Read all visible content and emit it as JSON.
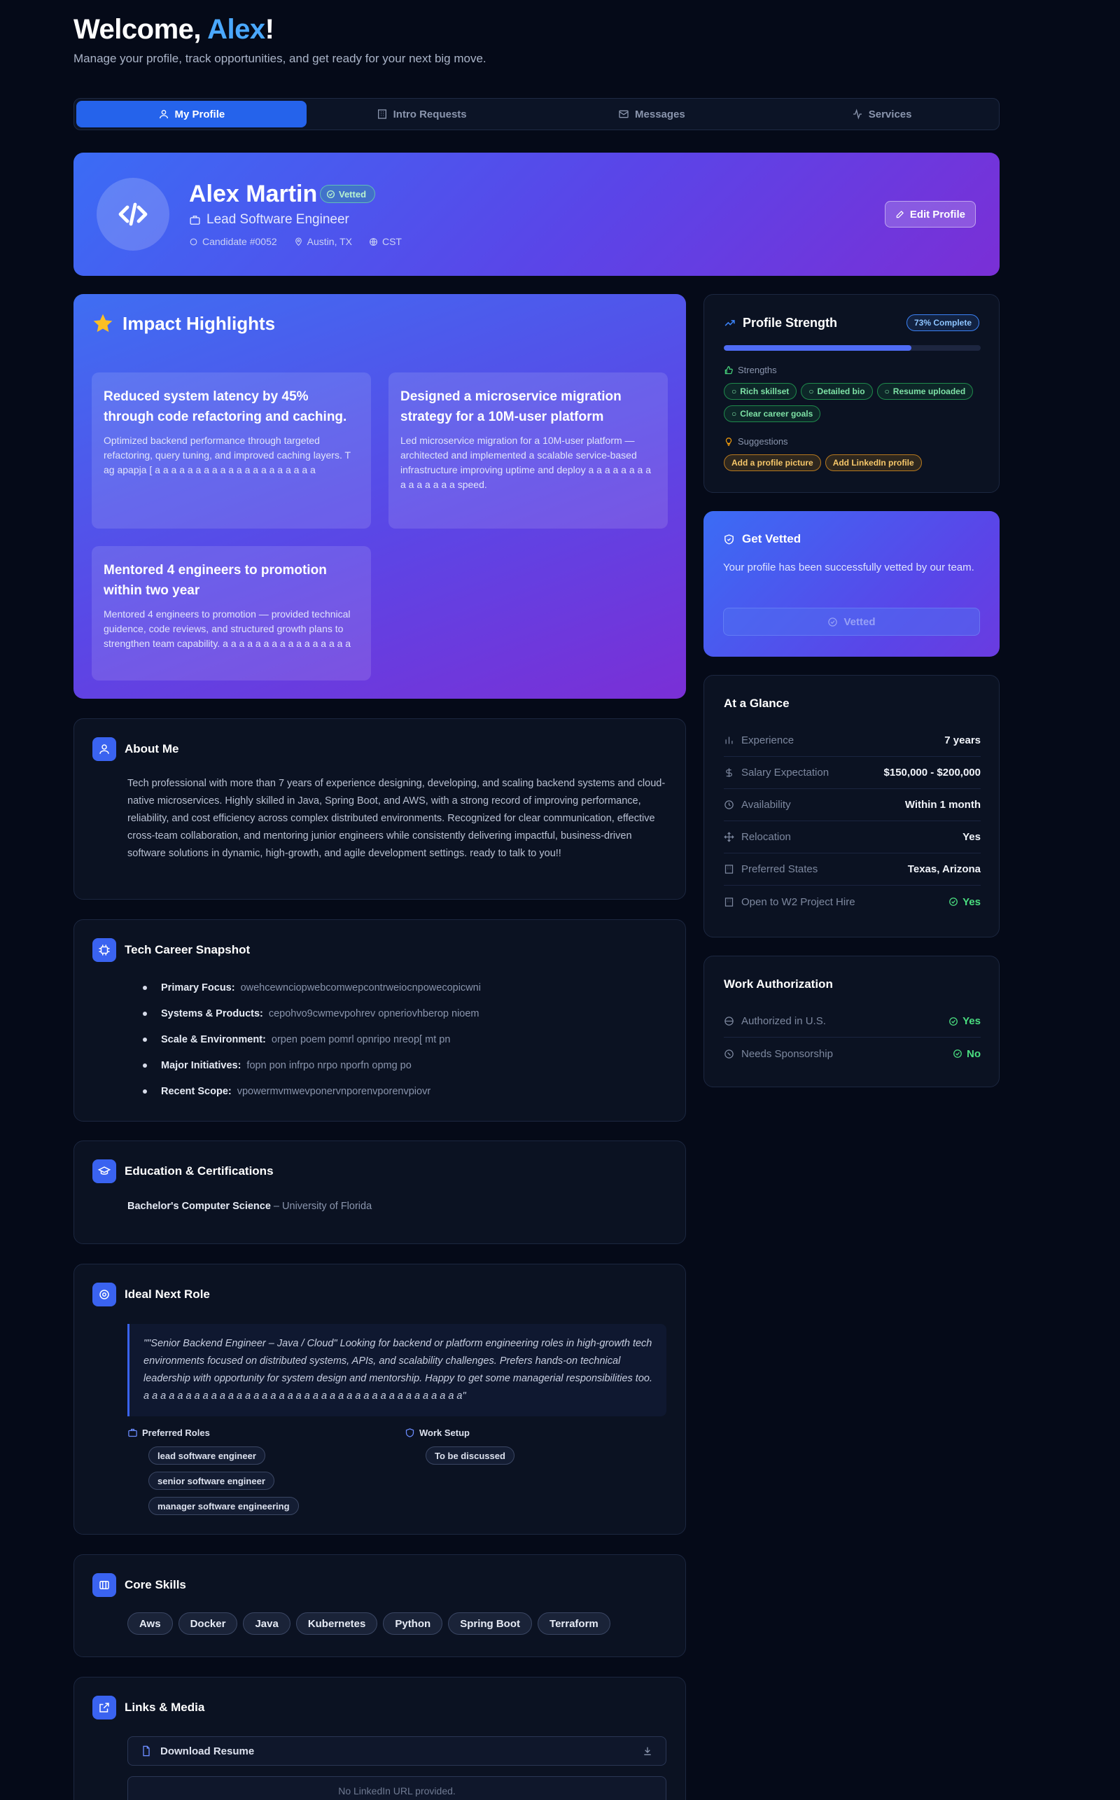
{
  "header": {
    "welcome_prefix": "Welcome, ",
    "welcome_name": "Alex",
    "welcome_suffix": "!",
    "subtitle": "Manage your profile, track opportunities, and get ready for your next big move."
  },
  "tabs": [
    {
      "label": "My Profile",
      "icon": "user-icon",
      "active": true
    },
    {
      "label": "Intro Requests",
      "icon": "building-icon",
      "active": false
    },
    {
      "label": "Messages",
      "icon": "mail-icon",
      "active": false
    },
    {
      "label": "Services",
      "icon": "activity-icon",
      "active": false
    }
  ],
  "profile": {
    "name": "Alex Martin",
    "badge": "Vetted",
    "role": "Lead Software Engineer",
    "candidate_id": "Candidate #0052",
    "location": "Austin, TX",
    "timezone": "CST",
    "edit_label": "Edit Profile"
  },
  "impact": {
    "title": "Impact Highlights",
    "items": [
      {
        "title": "Reduced system latency by 45% through code refactoring and caching.",
        "desc": "Optimized backend performance through targeted refactoring, query tuning, and improved caching layers. T ag apapja [ a a a a a a a a a a a a a a a a a a a a"
      },
      {
        "title": "Designed a microservice migration strategy for a 10M-user platform",
        "desc": "Led microservice migration for a 10M-user platform — architected and implemented a scalable service-based infrastructure improving uptime and deploy a a a a a a a a a a a a a a a speed."
      },
      {
        "title": "Mentored 4 engineers to promotion within two year",
        "desc": "Mentored 4 engineers to promotion — provided technical guidence, code reviews, and structured growth plans to strengthen team capability. a a a a a a a a a a a a a a a a"
      }
    ]
  },
  "strength": {
    "title": "Profile Strength",
    "badge": "73% Complete",
    "progress": 0.73,
    "strengths_label": "Strengths",
    "strengths": [
      "Rich skillset",
      "Detailed bio",
      "Resume uploaded",
      "Clear career goals"
    ],
    "suggestions_label": "Suggestions",
    "suggestions": [
      "Add a profile picture",
      "Add LinkedIn profile"
    ]
  },
  "vetted": {
    "title": "Get Vetted",
    "text": "Your profile has been successfully vetted by our team.",
    "button": "Vetted"
  },
  "glance": {
    "title": "At a Glance",
    "rows": [
      {
        "key": "Experience",
        "value": "7 years"
      },
      {
        "key": "Salary Expectation",
        "value": "$150,000 - $200,000"
      },
      {
        "key": "Availability",
        "value": "Within 1 month"
      },
      {
        "key": "Relocation",
        "value": "Yes"
      },
      {
        "key": "Preferred States",
        "value": "Texas, Arizona"
      },
      {
        "key": "Open to W2 Project Hire",
        "value": "Yes"
      }
    ]
  },
  "work_auth": {
    "title": "Work Authorization",
    "rows": [
      {
        "key": "Authorized in U.S.",
        "value": "Yes"
      },
      {
        "key": "Needs Sponsorship",
        "value": "No"
      }
    ]
  },
  "about": {
    "title": "About Me",
    "text": "Tech professional with more than 7 years of experience designing, developing, and scaling backend systems and cloud-native microservices. Highly skilled in Java, Spring Boot, and AWS, with a strong record of improving performance, reliability, and cost efficiency across complex distributed environments. Recognized for clear communication, effective cross-team collaboration, and mentoring junior engineers while consistently delivering impactful, business-driven software solutions in dynamic, high-growth, and agile development settings. ready to talk to you!!"
  },
  "snapshot": {
    "title": "Tech Career Snapshot",
    "items": [
      {
        "label": "Primary Focus:",
        "value": "owehcewnciopwebcomwepcontrweiocnpowecopicwni"
      },
      {
        "label": "Systems & Products:",
        "value": "cepohvo9cwmevpohrev opneriovhberop nioem"
      },
      {
        "label": "Scale & Environment:",
        "value": "orpen poem pomrl opnripo nreop[ mt pn"
      },
      {
        "label": "Major Initiatives:",
        "value": "fopn pon infrpo nrpo nporfn opmg po"
      },
      {
        "label": "Recent Scope:",
        "value": "vpowermvmwevponervnporenvporenvpiovr"
      }
    ]
  },
  "education": {
    "title": "Education & Certifications",
    "degree": "Bachelor's Computer Science",
    "school": " – University of Florida"
  },
  "next_role": {
    "title": "Ideal Next Role",
    "quote": "\"\"Senior Backend Engineer – Java / Cloud\" Looking for backend or platform engineering roles in high-growth tech environments focused on distributed systems, APIs, and scalability challenges. Prefers hands-on technical leadership with opportunity for system design and mentorship. Happy to get some managerial responsibilities too. a a a a a a a a a a a a a a a a a a a a a a a a a a a a a a a a a a a a a a\"",
    "roles_label": "Preferred Roles",
    "roles": [
      "lead software engineer",
      "senior software engineer",
      "manager software engineering"
    ],
    "setup_label": "Work Setup",
    "setup": "To be discussed"
  },
  "skills": {
    "title": "Core Skills",
    "items": [
      "Aws",
      "Docker",
      "Java",
      "Kubernetes",
      "Python",
      "Spring Boot",
      "Terraform"
    ]
  },
  "links": {
    "title": "Links & Media",
    "resume": "Download Resume",
    "linkedin_empty": "No LinkedIn URL provided."
  }
}
